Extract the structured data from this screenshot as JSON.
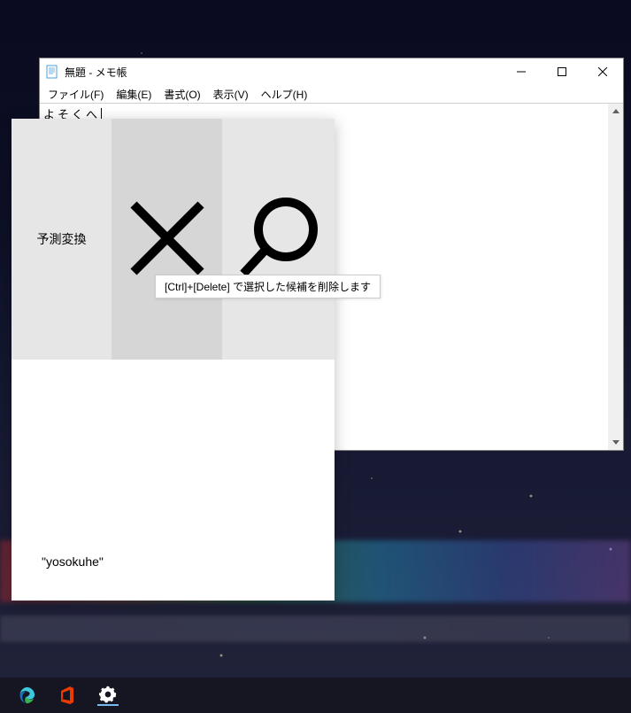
{
  "window": {
    "title": "無題 - メモ帳"
  },
  "menubar": {
    "file": "ファイル(F)",
    "edit": "編集(E)",
    "format": "書式(O)",
    "view": "表示(V)",
    "help": "ヘルプ(H)"
  },
  "editor": {
    "composition_text": "よそくへ"
  },
  "ime": {
    "label_predictive": "予測変換",
    "tooltip_text": "[Ctrl]+[Delete] で選択した候補を削除します",
    "roman_reading": "\"yosokuhe\""
  }
}
